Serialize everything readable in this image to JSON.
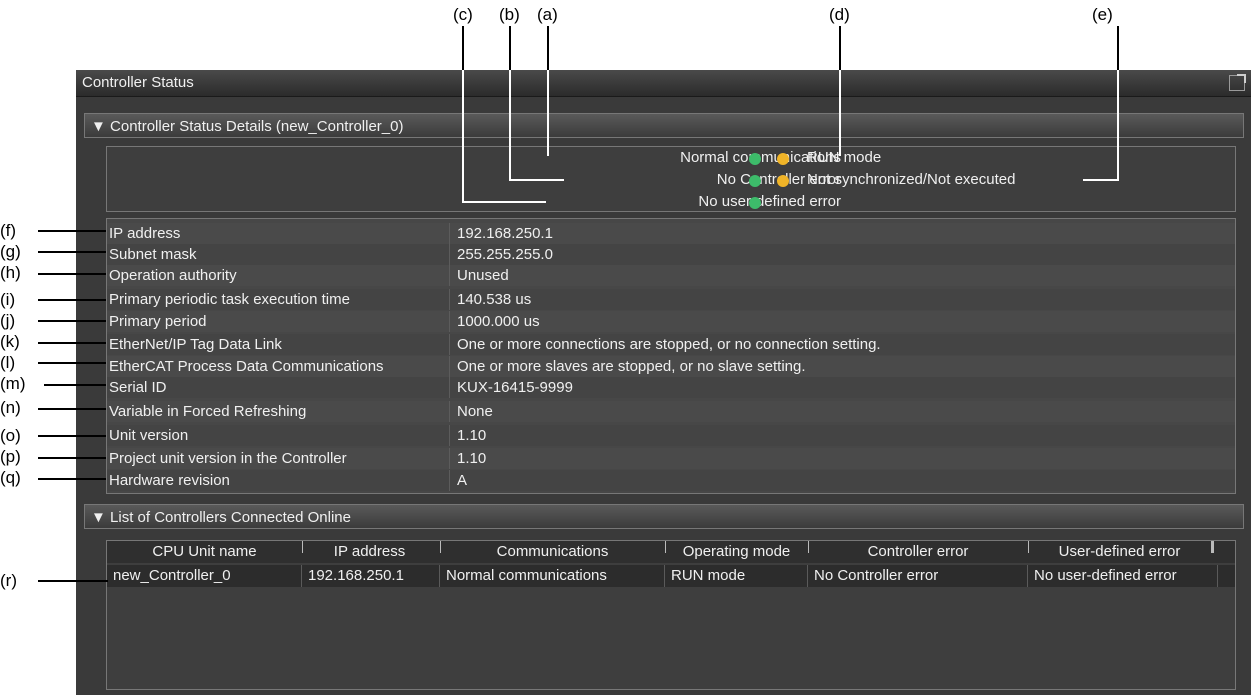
{
  "callouts": {
    "top": [
      "(c)",
      "(b)",
      "(a)",
      "(d)",
      "(e)"
    ],
    "left": [
      "(f)",
      "(g)",
      "(h)",
      "(i)",
      "(j)",
      "(k)",
      "(l)",
      "(m)",
      "(n)",
      "(o)",
      "(p)",
      "(q)",
      "(r)"
    ]
  },
  "window": {
    "title": "Controller Status"
  },
  "details": {
    "header": "▼ Controller Status Details (new_Controller_0)",
    "normal_comm": "Normal communications",
    "controller_error": "No Controller error",
    "user_error": "No user-defined error",
    "run_mode": "RUN mode",
    "sync": "Not synchronized/Not executed",
    "colors": {
      "green": "#3dbb6a",
      "yellow": "#f0b428"
    }
  },
  "properties": [
    {
      "name": "IP address",
      "value": "192.168.250.1"
    },
    {
      "name": "Subnet mask",
      "value": "255.255.255.0"
    },
    {
      "name": "Operation authority",
      "value": "Unused"
    },
    {
      "name": "Primary periodic task execution time",
      "value": "140.538 us"
    },
    {
      "name": "Primary period",
      "value": "1000.000 us"
    },
    {
      "name": "EtherNet/IP Tag Data Link",
      "value": "One or more connections are stopped, or no connection setting."
    },
    {
      "name": "EtherCAT Process Data Communications",
      "value": "One or more slaves are stopped, or no slave setting."
    },
    {
      "name": "Serial ID",
      "value": "KUX-16415-9999"
    },
    {
      "name": "Variable in Forced Refreshing",
      "value": "None"
    },
    {
      "name": "Unit version",
      "value": "1.10"
    },
    {
      "name": "Project unit version in the Controller",
      "value": "1.10"
    },
    {
      "name": "Hardware revision",
      "value": "A"
    }
  ],
  "list": {
    "header": "▼ List of Controllers Connected Online",
    "columns": [
      "CPU Unit name",
      "IP address",
      "Communications",
      "Operating mode",
      "Controller error",
      "User-defined error"
    ],
    "rows": [
      [
        "new_Controller_0",
        "192.168.250.1",
        "Normal communications",
        "RUN mode",
        "No Controller error",
        "No user-defined error"
      ]
    ]
  }
}
